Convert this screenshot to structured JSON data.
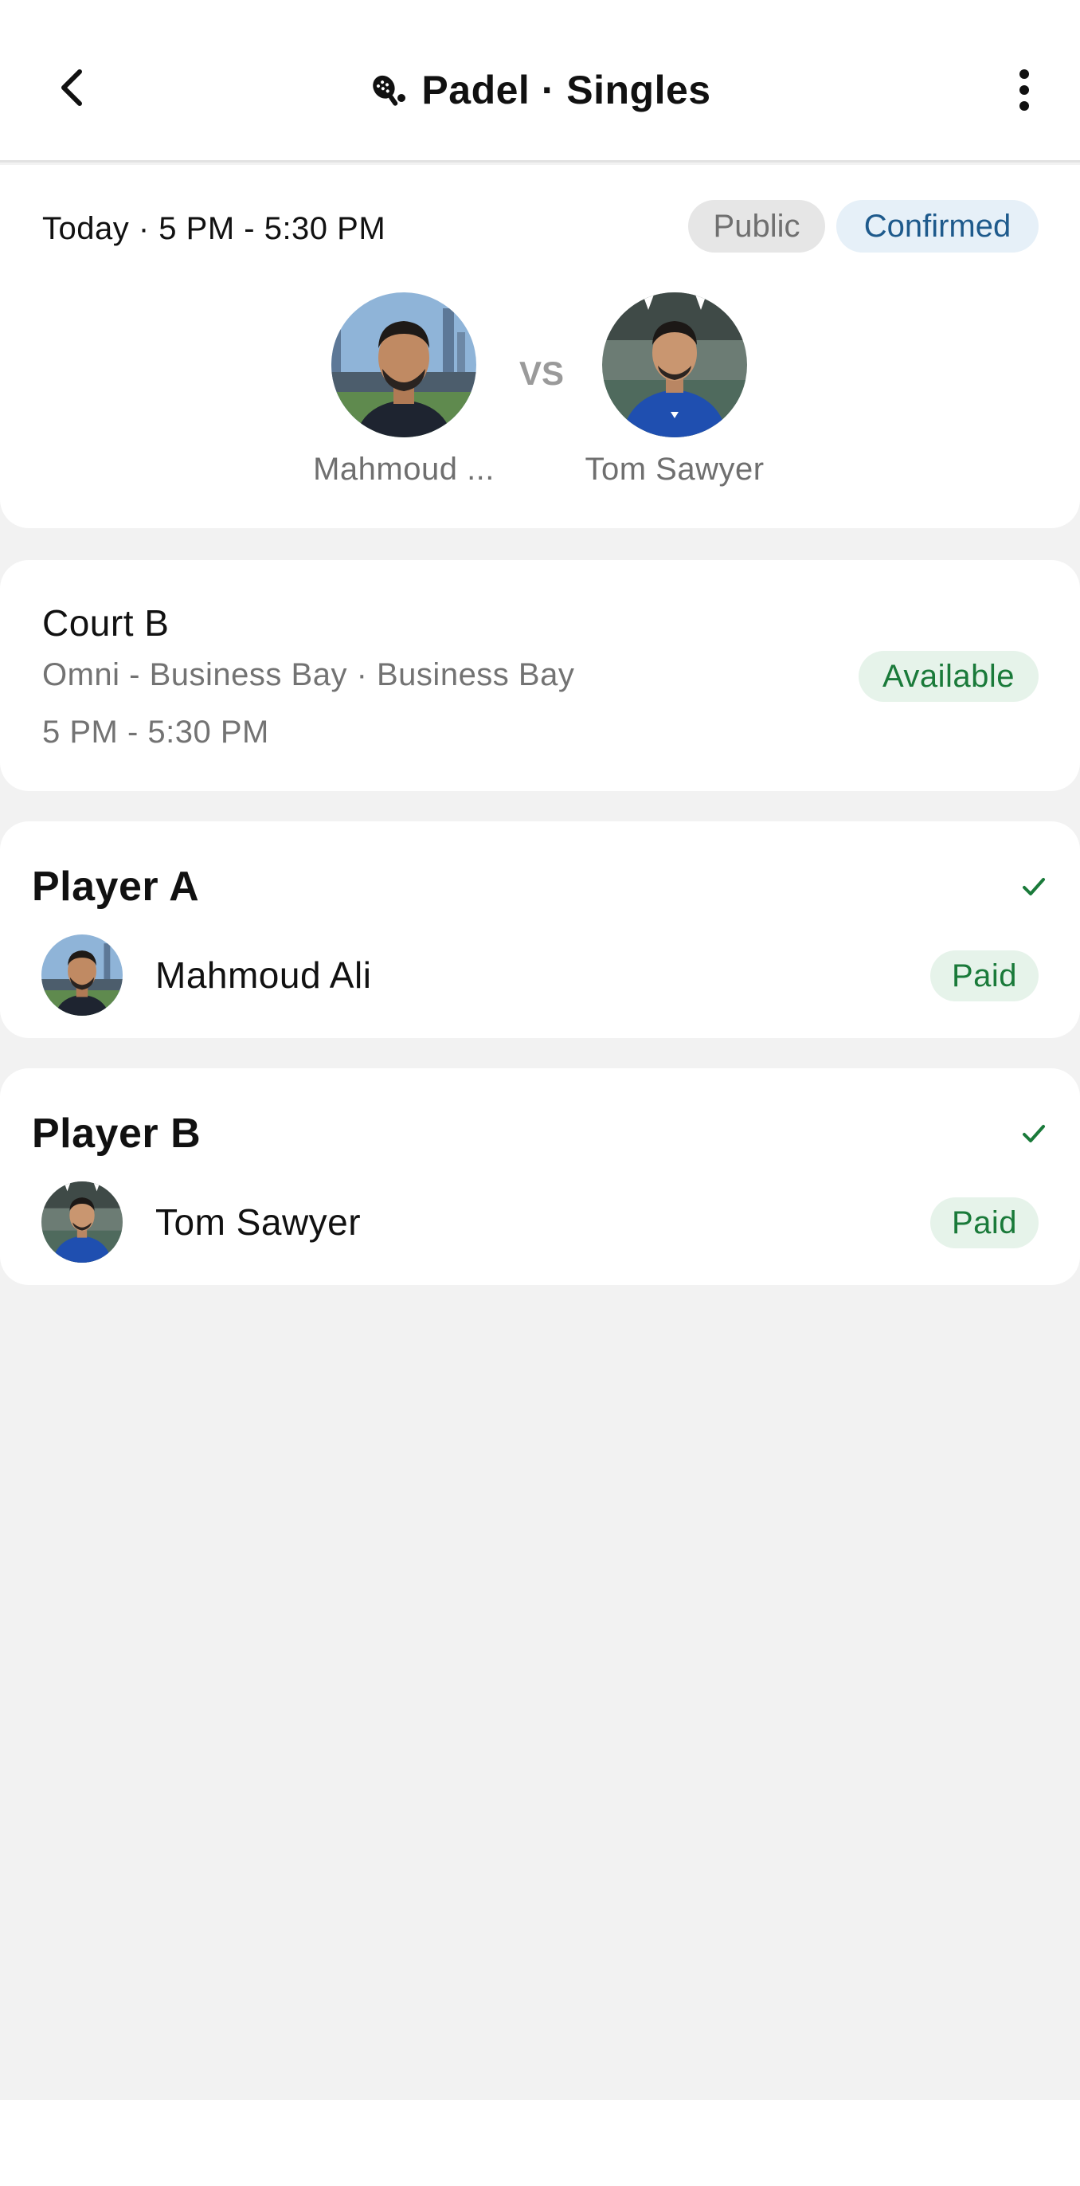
{
  "header": {
    "title": "Padel · Singles",
    "back_icon": "chevron-left-icon",
    "sport_icon": "padel-racket-icon",
    "more_icon": "more-vertical-icon"
  },
  "summary": {
    "when": "Today · 5 PM - 5:30 PM",
    "visibility": "Public",
    "status": "Confirmed",
    "vs_label": "VS",
    "player_a_short": "Mahmoud ...",
    "player_b_short": "Tom Sawyer"
  },
  "court": {
    "name": "Court B",
    "venue": "Omni - Business Bay · Business Bay",
    "time": "5 PM - 5:30 PM",
    "availability": "Available"
  },
  "players": [
    {
      "heading": "Player A",
      "name": "Mahmoud Ali",
      "payment": "Paid",
      "checked": true
    },
    {
      "heading": "Player B",
      "name": "Tom Sawyer",
      "payment": "Paid",
      "checked": true
    }
  ],
  "colors": {
    "accent_blue": "#1e5a8c",
    "success_green": "#1a7a3a",
    "background": "#f2f2f2"
  }
}
